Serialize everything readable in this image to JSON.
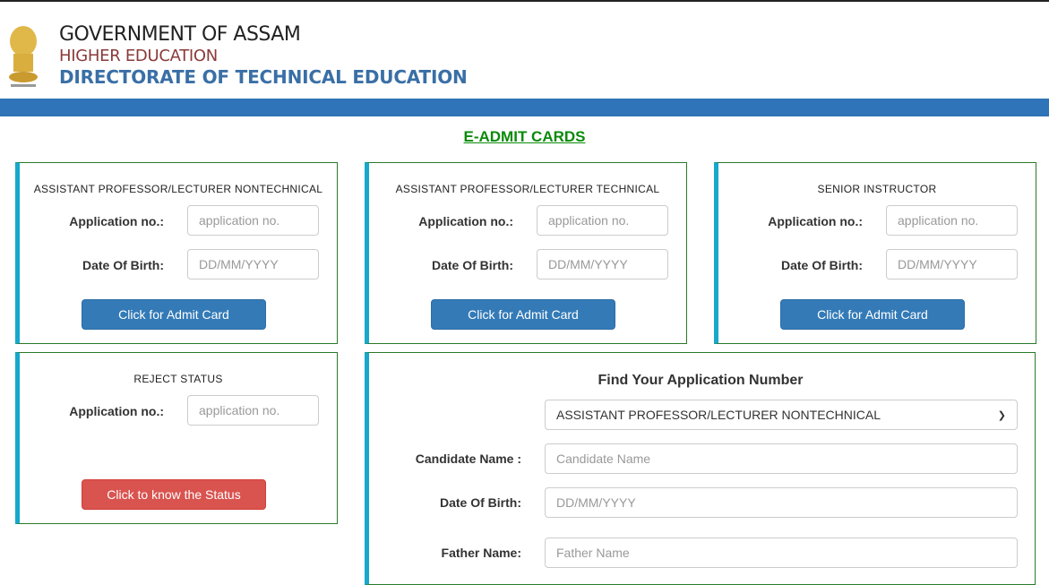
{
  "header": {
    "line1": "GOVERNMENT OF ASSAM",
    "line2": "HIGHER EDUCATION",
    "line3": "DIRECTORATE OF TECHNICAL EDUCATION",
    "emblem_icon": "state-emblem-icon"
  },
  "page_title": "E-ADMIT CARDS",
  "cards": [
    {
      "title": "ASSISTANT PROFESSOR/LECTURER NONTECHNICAL",
      "app_label": "Application no.:",
      "app_placeholder": "application no.",
      "dob_label": "Date Of Birth:",
      "dob_placeholder": "DD/MM/YYYY",
      "button": "Click for Admit Card"
    },
    {
      "title": "ASSISTANT PROFESSOR/LECTURER TECHNICAL",
      "app_label": "Application no.:",
      "app_placeholder": "application no.",
      "dob_label": "Date Of Birth:",
      "dob_placeholder": "DD/MM/YYYY",
      "button": "Click for Admit Card"
    },
    {
      "title": "SENIOR INSTRUCTOR",
      "app_label": "Application no.:",
      "app_placeholder": "application no.",
      "dob_label": "Date Of Birth:",
      "dob_placeholder": "DD/MM/YYYY",
      "button": "Click for Admit Card"
    }
  ],
  "reject": {
    "title": "REJECT STATUS",
    "app_label": "Application no.:",
    "app_placeholder": "application no.",
    "button": "Click to know the Status"
  },
  "find": {
    "title": "Find Your Application Number",
    "post_selected": "ASSISTANT PROFESSOR/LECTURER NONTECHNICAL",
    "name_label": "Candidate Name :",
    "name_placeholder": "Candidate Name",
    "dob_label": "Date Of Birth:",
    "dob_placeholder": "DD/MM/YYYY",
    "father_label": "Father Name:",
    "father_placeholder": "Father Name"
  },
  "colors": {
    "band": "#2f74b8",
    "title": "#0a8a0a",
    "primary": "#337ab7",
    "danger": "#d9534f",
    "card_accent": "#17a8cc"
  }
}
